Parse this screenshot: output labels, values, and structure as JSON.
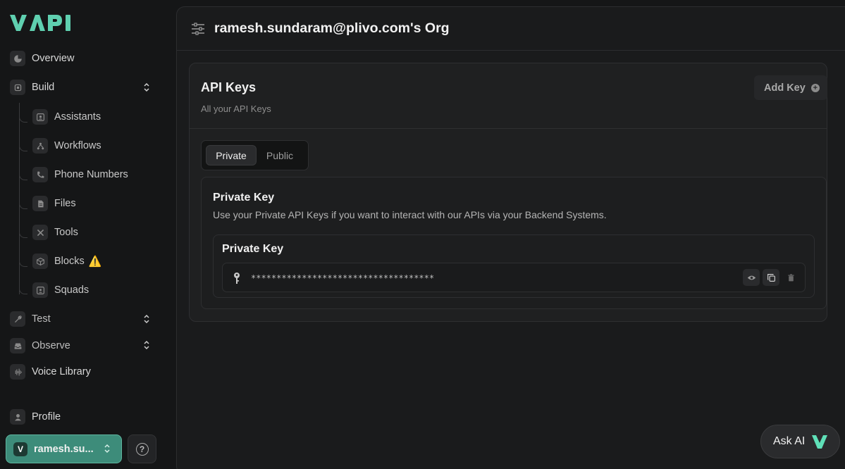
{
  "brand": {
    "logo_text": "VAPI",
    "accent": "#5fd0b0"
  },
  "sidebar": {
    "overview": "Overview",
    "build": "Build",
    "build_items": [
      {
        "label": "Assistants",
        "icon": "assistant-icon"
      },
      {
        "label": "Workflows",
        "icon": "workflow-icon"
      },
      {
        "label": "Phone Numbers",
        "icon": "phone-icon"
      },
      {
        "label": "Files",
        "icon": "file-icon"
      },
      {
        "label": "Tools",
        "icon": "tools-icon"
      },
      {
        "label": "Blocks",
        "icon": "cube-icon",
        "badge": "⚠️"
      },
      {
        "label": "Squads",
        "icon": "squad-icon"
      }
    ],
    "test": "Test",
    "observe": "Observe",
    "voice_library": "Voice Library",
    "profile": "Profile",
    "org_button": {
      "avatar": "V",
      "label": "ramesh.su..."
    }
  },
  "header": {
    "title": "ramesh.sundaram@plivo.com's Org"
  },
  "api_keys": {
    "title": "API Keys",
    "subtitle": "All your API Keys",
    "add_key": "Add Key",
    "tabs": [
      {
        "label": "Private",
        "active": true
      },
      {
        "label": "Public",
        "active": false
      }
    ],
    "private_section": {
      "title": "Private Key",
      "description": "Use your Private API Keys if you want to interact with our APIs via your Backend Systems.",
      "key_box_title": "Private Key",
      "masked_key": "************************************"
    }
  },
  "ask_ai": {
    "label": "Ask AI"
  }
}
